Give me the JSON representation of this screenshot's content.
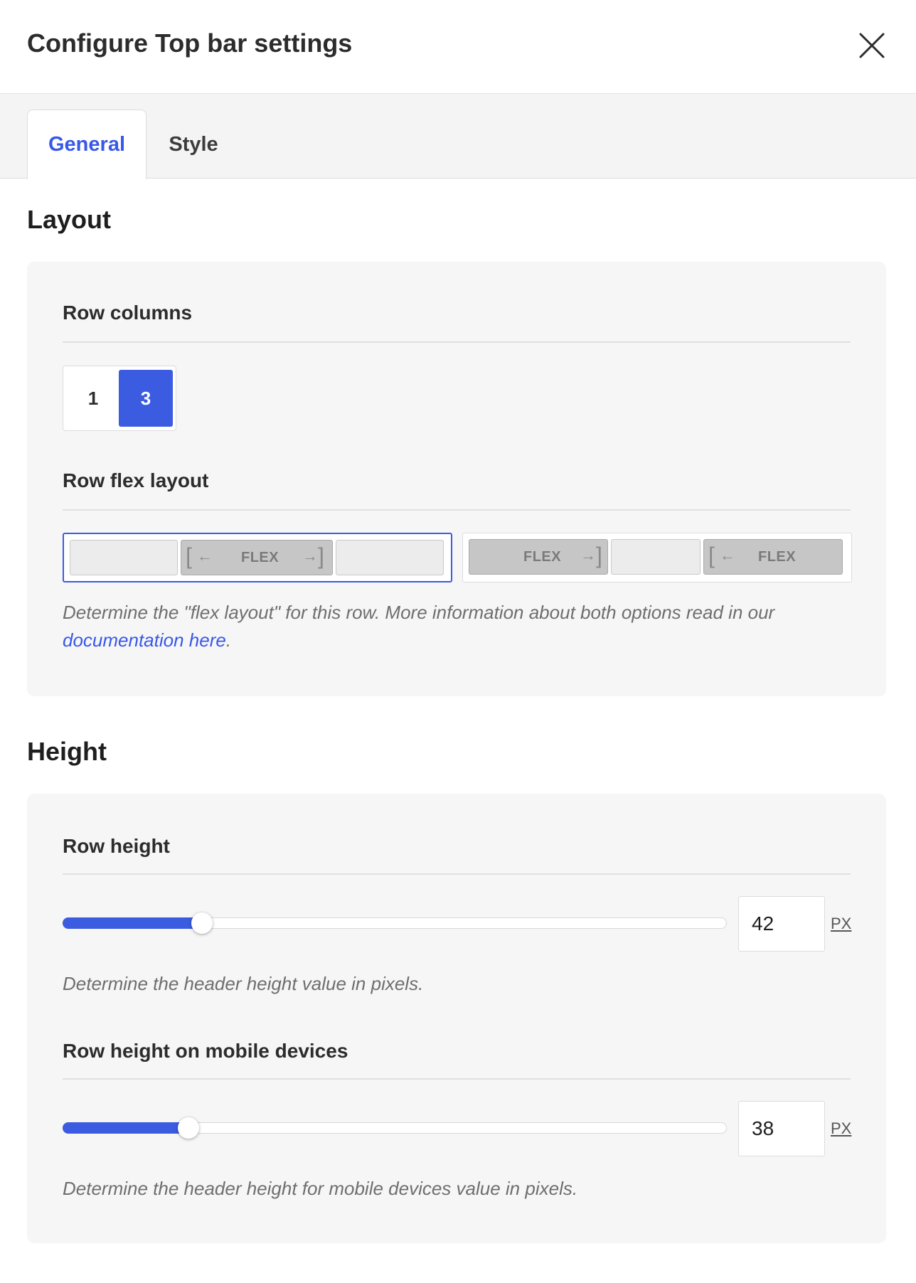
{
  "header": {
    "title": "Configure Top bar settings",
    "close_icon": "close-icon"
  },
  "tabs": [
    {
      "label": "General",
      "active": true
    },
    {
      "label": "Style",
      "active": false
    }
  ],
  "layout": {
    "title": "Layout",
    "row_columns": {
      "label": "Row columns",
      "options": [
        "1",
        "3"
      ],
      "selected": "3"
    },
    "row_flex_layout": {
      "label": "Row flex layout",
      "options": [
        {
          "flex_label": "FLEX",
          "selected": true
        },
        {
          "flex_left_label": "FLEX",
          "flex_right_label": "FLEX",
          "selected": false
        }
      ],
      "help_text": "Determine the \"flex layout\" for this row. More information about both options read in our ",
      "help_link": "documentation here",
      "help_suffix": "."
    }
  },
  "height": {
    "title": "Height",
    "row_height": {
      "label": "Row height",
      "value": "42",
      "unit": "PX",
      "slider_fraction": 0.21,
      "help_text": "Determine the header height value in pixels."
    },
    "row_height_mobile": {
      "label": "Row height on mobile devices",
      "value": "38",
      "unit": "PX",
      "slider_fraction": 0.19,
      "help_text": "Determine the header height for mobile devices value in pixels."
    }
  },
  "colors": {
    "accent": "#3b5be0",
    "panel_bg": "#f6f6f6"
  }
}
